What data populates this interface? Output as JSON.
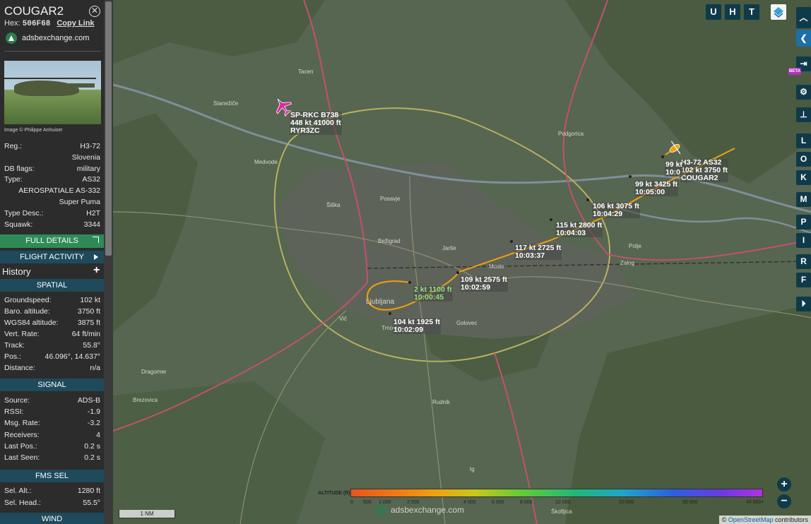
{
  "sidebar": {
    "callsign": "COUGAR2",
    "hex_label": "Hex:",
    "hex_value": "506F68",
    "copy_link": "Copy Link",
    "brand": "adsbexchange.com",
    "photo_credit": "Image © Philippe Anhuiser",
    "details": [
      {
        "k": "Reg.:",
        "v": "H3-72"
      },
      {
        "k": "",
        "v": "Slovenia"
      },
      {
        "k": "DB flags:",
        "v": "military"
      },
      {
        "k": "Type:",
        "v": "AS32"
      },
      {
        "k": "",
        "v": "AEROSPATIALE AS-332"
      },
      {
        "k": "",
        "v": "Super Puma"
      },
      {
        "k": "Type Desc.:",
        "v": "H2T"
      },
      {
        "k": "Squawk:",
        "v": "3344"
      }
    ],
    "full_details": "FULL DETAILS",
    "flight_activity": "FLIGHT ACTIVITY",
    "history": "History",
    "spatial_title": "SPATIAL",
    "spatial": [
      {
        "k": "Groundspeed:",
        "v": "102 kt"
      },
      {
        "k": "Baro. altitude:",
        "v": "3750 ft"
      },
      {
        "k": "WGS84 altitude:",
        "v": "3875 ft"
      },
      {
        "k": "Vert. Rate:",
        "v": "64 ft/min"
      },
      {
        "k": "Track:",
        "v": "55.8°"
      },
      {
        "k": "Pos.:",
        "v": "46.096°, 14.637°"
      },
      {
        "k": "Distance:",
        "v": "n/a"
      }
    ],
    "signal_title": "SIGNAL",
    "signal": [
      {
        "k": "Source:",
        "v": "ADS-B"
      },
      {
        "k": "RSSI:",
        "v": "-1.9"
      },
      {
        "k": "Msg. Rate:",
        "v": "-3.2"
      },
      {
        "k": "Receivers:",
        "v": "4"
      },
      {
        "k": "Last Pos.:",
        "v": "0.2 s"
      },
      {
        "k": "Last Seen:",
        "v": "0.2 s"
      }
    ],
    "fms_title": "FMS SEL",
    "fms": [
      {
        "k": "Sel. Alt.:",
        "v": "1280 ft"
      },
      {
        "k": "Sel. Head.:",
        "v": "55.5°"
      }
    ],
    "wind_title": "WIND"
  },
  "map": {
    "top_buttons": [
      "U",
      "H",
      "T"
    ],
    "side_buttons": [
      "L",
      "O",
      "K",
      "M",
      "P",
      "I",
      "R",
      "F"
    ],
    "beta_badge": "BETA",
    "zoom_in": "+",
    "zoom_out": "−",
    "scale": "1 NM",
    "attribution_prefix": "© ",
    "attribution_link": "OpenStreetMap",
    "attribution_suffix": " contributors",
    "watermark": "adsbexchange.com",
    "other_aircraft": {
      "line1": "SP-RKC B738",
      "line2": "448 kt  41000 ft",
      "line3": "RYR3ZC",
      "color": "#d62aa0"
    },
    "selected_aircraft": {
      "line1": "H3-72 AS32",
      "line2": "102 kt  3750 ft",
      "line3": "COUGAR2",
      "color": "#f0a010"
    },
    "track_labels": [
      {
        "l1": "2 kt  1100 ft",
        "l2": "10:00:45"
      },
      {
        "l1": "104 kt  1925 ft",
        "l2": "10:02:09"
      },
      {
        "l1": "109 kt  2575 ft",
        "l2": "10:02:59"
      },
      {
        "l1": "117 kt  2725 ft",
        "l2": "10:03:37"
      },
      {
        "l1": "115 kt  2800 ft",
        "l2": "10:04:03"
      },
      {
        "l1": "106 kt  3075 ft",
        "l2": "10:04:29"
      },
      {
        "l1": "99 kt  3425 ft",
        "l2": "10:05:00"
      },
      {
        "l1": "99 kt",
        "l2": "10:0"
      }
    ],
    "altitude_legend": {
      "title": "ALTITUDE (ft)",
      "ticks": [
        "0",
        "500",
        "1 000",
        "2 000",
        "4 000",
        "6 000",
        "8 000",
        "10 000",
        "20 000",
        "30 000",
        "40 000+"
      ]
    },
    "places": [
      "Ljubljana",
      "Bežigrad",
      "Šiška",
      "Posavje",
      "Jarše",
      "Polje",
      "Moste",
      "Vič",
      "Trnovo",
      "Rudnik",
      "Golovec",
      "Zalog",
      "Dragomer",
      "Brezovica",
      "Ig",
      "Škofljica",
      "Tacen",
      "Stanežiče",
      "Medvode",
      "Podgorica"
    ]
  }
}
